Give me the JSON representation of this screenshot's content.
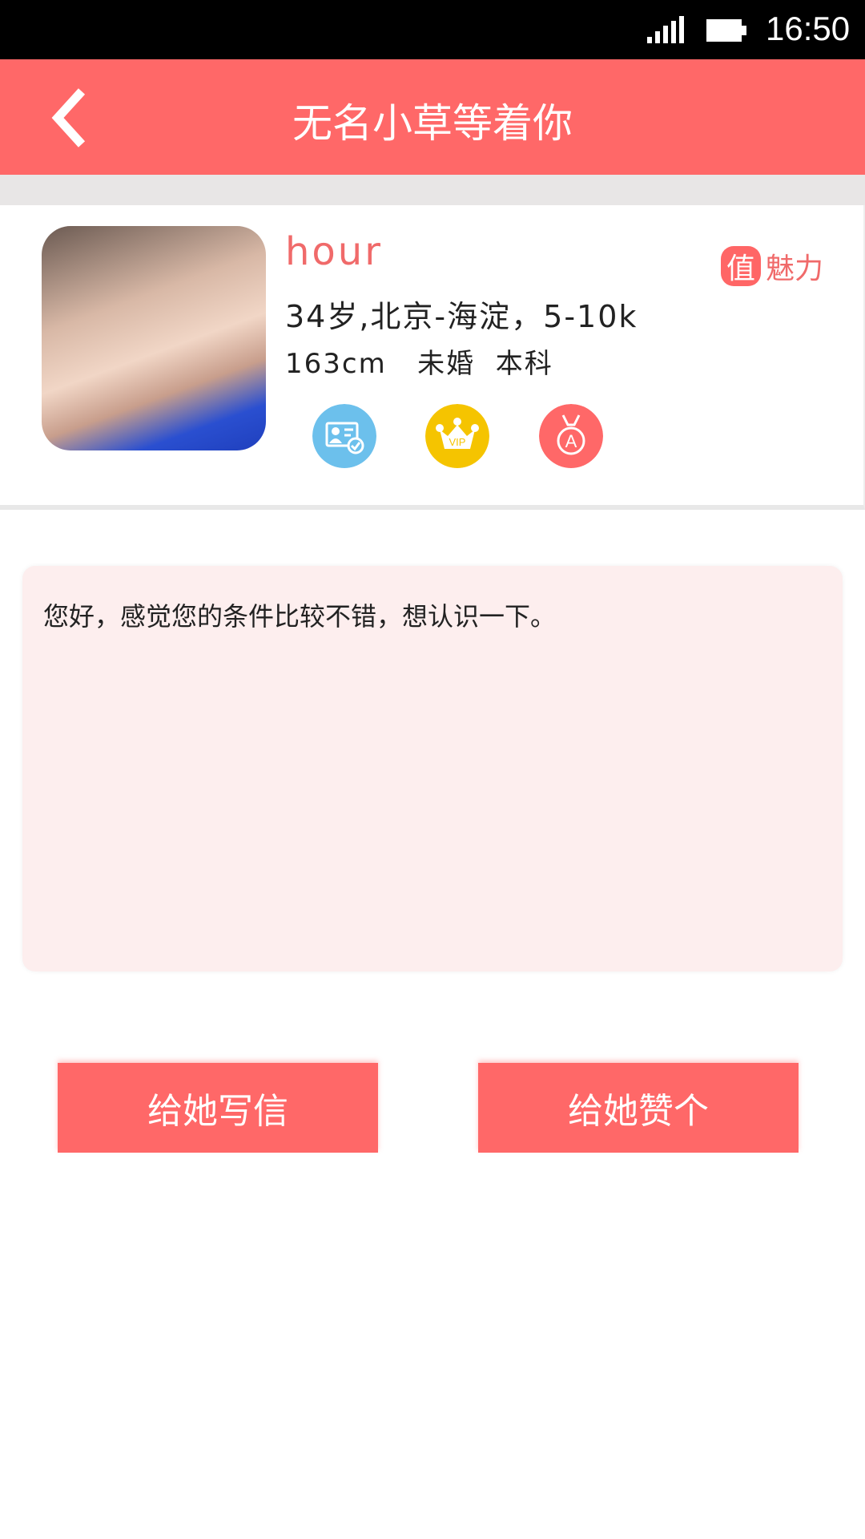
{
  "status_bar": {
    "time": "16:50",
    "signal_icon": "signal-icon",
    "battery_icon": "battery-icon"
  },
  "header": {
    "title": "无名小草等着你",
    "back_icon": "chevron-left-icon"
  },
  "profile": {
    "name": "hour",
    "charm_badge": "值",
    "charm_label": "魅力",
    "info_line1": "34岁,北京-海淀，5-10k",
    "info_line2": "163cm   未婚  本科",
    "badges": [
      {
        "icon": "id-verified-icon",
        "color": "#6cc0ec"
      },
      {
        "icon": "vip-crown-icon",
        "color": "#f5c400",
        "text": "VIP"
      },
      {
        "icon": "medal-icon",
        "color": "#ff6868",
        "text": "A"
      }
    ]
  },
  "message": {
    "text": "您好，感觉您的条件比较不错，想认识一下。"
  },
  "actions": {
    "write_letter": "给她写信",
    "like": "给她赞个"
  },
  "colors": {
    "accent": "#ff6868",
    "message_bg": "#fdeeee"
  }
}
